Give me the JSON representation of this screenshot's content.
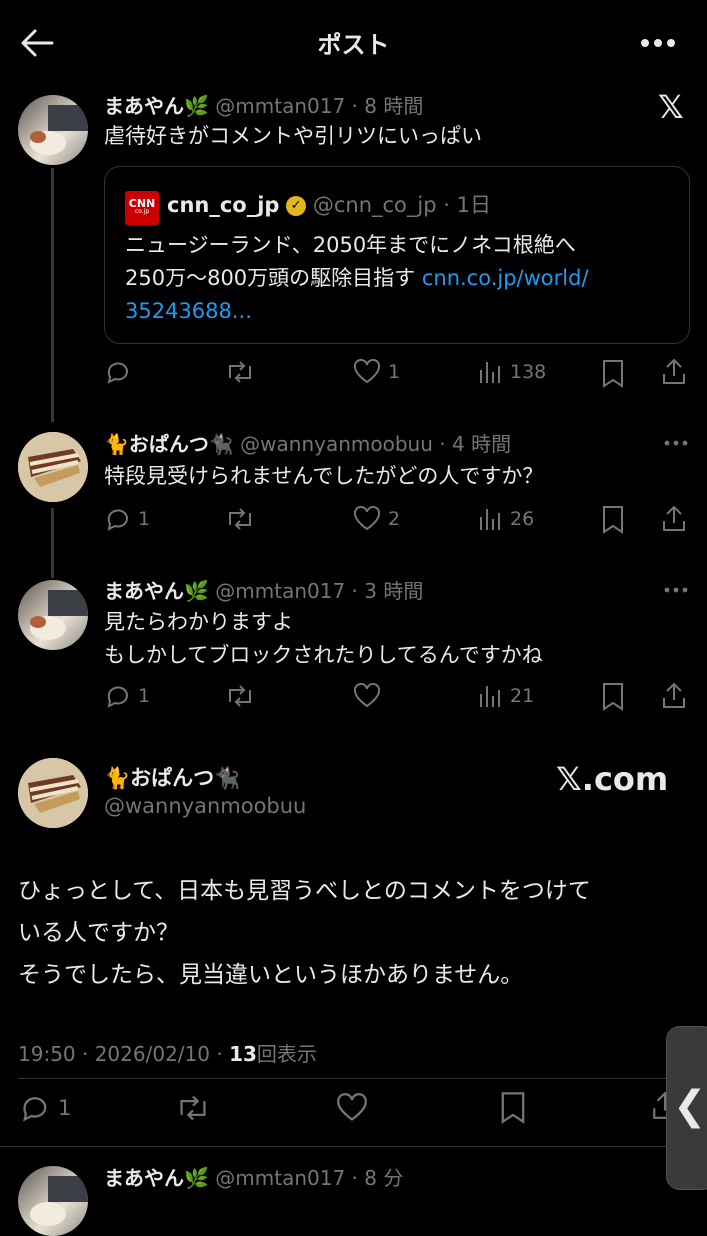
{
  "header": {
    "title": "ポスト"
  },
  "thread": [
    {
      "display_name": "まあやん🌿",
      "handle": "@mmtan017",
      "time": "8 時間",
      "text": "虐待好きがコメントや引リツにいっぱい",
      "quote": {
        "source_name": "cnn_co_jp",
        "handle": "@cnn_co_jp",
        "time": "1日",
        "logo_text": "CNN",
        "logo_subtext": "co.jp",
        "text_line1": "ニュージーランド、2050年までにノネコ根絶へ",
        "text_line2": "250万〜800万頭の駆除目指す ",
        "link_a": "cnn.co.jp/world/",
        "link_b": "35243688..."
      },
      "replies": "",
      "likes": "1",
      "views": "138"
    },
    {
      "display_name": "🐈おぱんつ🐈‍⬛",
      "handle": "@wannyanmoobuu",
      "time": "4 時間",
      "text": "特段見受けられませんでしたがどの人ですか？",
      "replies": "1",
      "likes": "2",
      "views": "26"
    },
    {
      "display_name": "まあやん🌿",
      "handle": "@mmtan017",
      "time": "3 時間",
      "text_line1": "見たらわかりますよ",
      "text_line2": "もしかしてブロックされたりしてるんですかね",
      "replies": "1",
      "likes": "",
      "views": "21"
    }
  ],
  "main_post": {
    "display_name": "🐈おぱんつ🐈‍⬛",
    "handle": "@wannyanmoobuu",
    "watermark": "𝕏.com",
    "text_line1": "ひょっとして、日本も見習うべしとのコメントをつけて",
    "text_line2": "いる人ですか？",
    "text_line3": "そうでしたら、見当違いというほかありません。",
    "timestamp": "19:50 · 2026/02/10 · ",
    "view_count": "13",
    "view_label": "回表示",
    "replies": "1"
  },
  "next_reply": {
    "display_name": "まあやん🌿",
    "handle": "@mmtan017",
    "time": "8 分"
  },
  "side_handle": {
    "glyph": "❮"
  }
}
